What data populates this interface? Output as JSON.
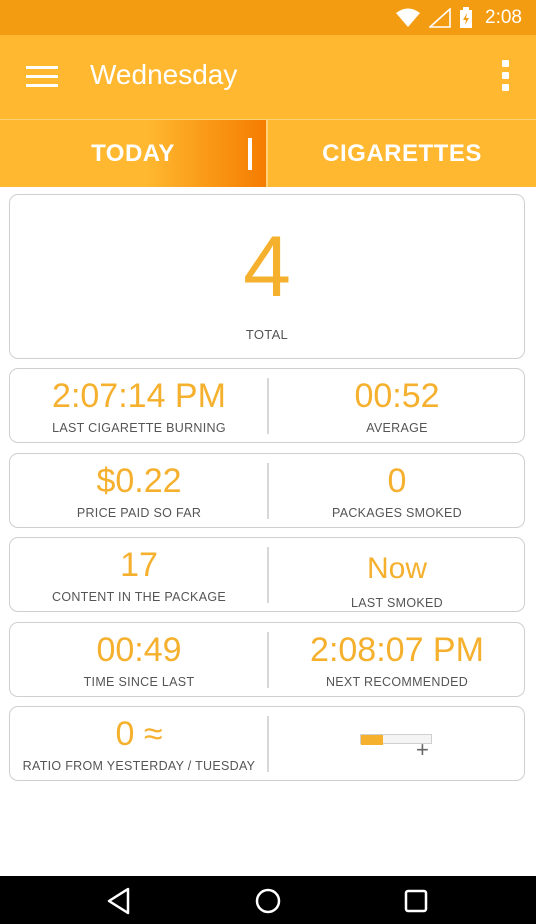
{
  "status_bar": {
    "time": "2:08"
  },
  "app_bar": {
    "title": "Wednesday"
  },
  "tabs": [
    {
      "label": "TODAY"
    },
    {
      "label": "CIGARETTES"
    }
  ],
  "total": {
    "value": "4",
    "label": "TOTAL"
  },
  "rows": [
    {
      "left": {
        "value": "2:07:14 PM",
        "label": "LAST CIGARETTE BURNING"
      },
      "right": {
        "value": "00:52",
        "label": "AVERAGE"
      }
    },
    {
      "left": {
        "value": "$0.22",
        "label": "PRICE PAID SO FAR"
      },
      "right": {
        "value": "0",
        "label": "PACKAGES SMOKED"
      }
    },
    {
      "left": {
        "value": "17",
        "label": "CONTENT IN THE PACKAGE"
      },
      "right": {
        "value": "Now",
        "label": "LAST SMOKED"
      }
    },
    {
      "left": {
        "value": "00:49",
        "label": "TIME SINCE LAST"
      },
      "right": {
        "value": "2:08:07 PM",
        "label": "NEXT RECOMMENDED"
      }
    },
    {
      "left": {
        "value": "0 ≈",
        "label": "RATIO FROM YESTERDAY / TUESDAY"
      }
    }
  ],
  "ratio_progress": {
    "fraction": 0.32
  },
  "colors": {
    "accent": "#f5b02e",
    "app_bar": "#ffb830",
    "status_bar": "#f39c12"
  },
  "icons": [
    "menu-icon",
    "more-vert-icon",
    "wifi-icon",
    "signal-icon",
    "battery-charging-icon",
    "plus-icon",
    "back-icon",
    "home-icon",
    "recents-icon"
  ]
}
